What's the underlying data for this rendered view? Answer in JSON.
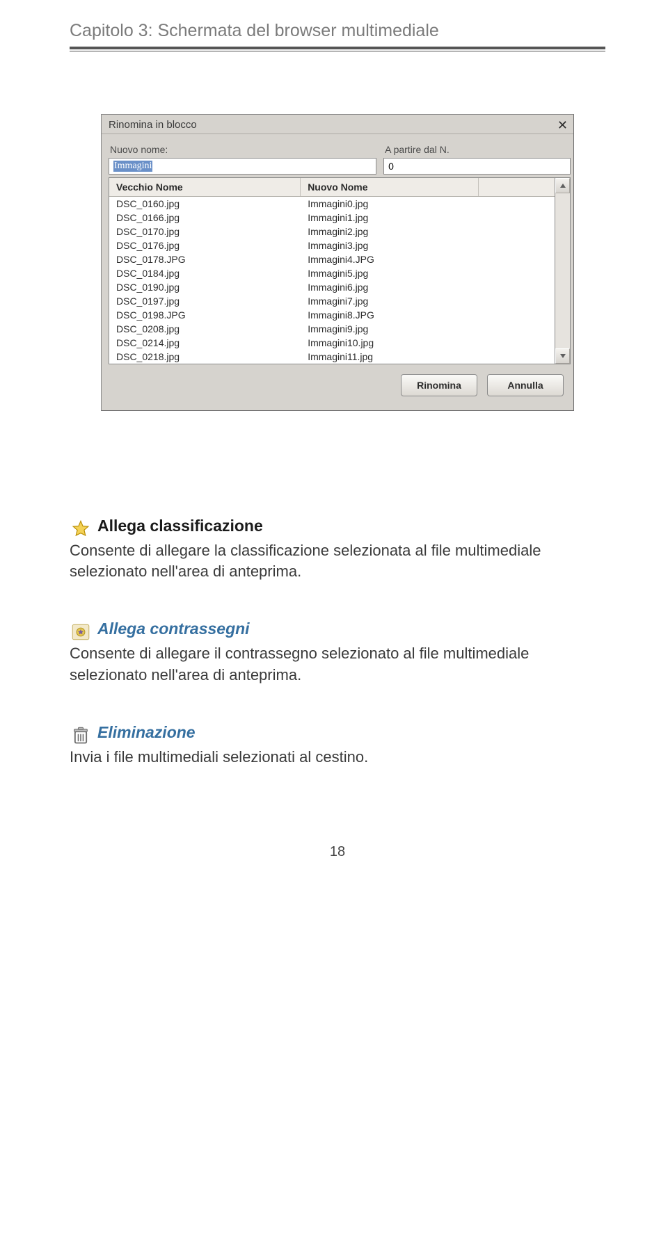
{
  "chapter_header": "Capitolo 3: Schermata del browser multimediale",
  "dialog": {
    "title": "Rinomina in blocco",
    "name_label": "Nuovo nome:",
    "name_value": "Immagini",
    "num_label": "A partire dal N.",
    "num_value": "0",
    "col_old": "Vecchio Nome",
    "col_new": "Nuovo Nome",
    "rows": [
      {
        "old": "DSC_0160.jpg",
        "new": "Immagini0.jpg"
      },
      {
        "old": "DSC_0166.jpg",
        "new": "Immagini1.jpg"
      },
      {
        "old": "DSC_0170.jpg",
        "new": "Immagini2.jpg"
      },
      {
        "old": "DSC_0176.jpg",
        "new": "Immagini3.jpg"
      },
      {
        "old": "DSC_0178.JPG",
        "new": "Immagini4.JPG"
      },
      {
        "old": "DSC_0184.jpg",
        "new": "Immagini5.jpg"
      },
      {
        "old": "DSC_0190.jpg",
        "new": "Immagini6.jpg"
      },
      {
        "old": "DSC_0197.jpg",
        "new": "Immagini7.jpg"
      },
      {
        "old": "DSC_0198.JPG",
        "new": "Immagini8.JPG"
      },
      {
        "old": "DSC_0208.jpg",
        "new": "Immagini9.jpg"
      },
      {
        "old": "DSC_0214.jpg",
        "new": "Immagini10.jpg"
      },
      {
        "old": "DSC_0218.jpg",
        "new": "Immagini11.jpg"
      }
    ],
    "btn_rename": "Rinomina",
    "btn_cancel": "Annulla"
  },
  "sections": {
    "rating": {
      "title": "Allega classificazione",
      "body": "Consente di allegare la classificazione selezionata al file multimediale selezionato nell'area di anteprima."
    },
    "tags": {
      "title": "Allega contrassegni",
      "body": "Consente di allegare il contrassegno selezionato al file multimediale selezionato nell'area di anteprima."
    },
    "delete": {
      "title": "Eliminazione",
      "body": "Invia i file multimediali selezionati al cestino."
    }
  },
  "page_number": "18"
}
